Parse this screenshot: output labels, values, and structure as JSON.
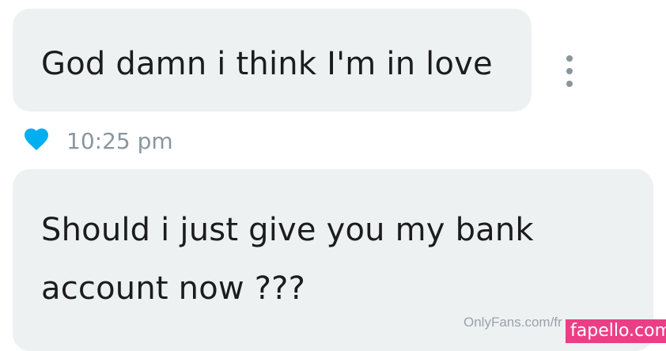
{
  "messages": [
    {
      "text": "God damn i think I'm in love"
    },
    {
      "text": "Should i just give you my bank account now ???"
    }
  ],
  "message_meta": {
    "time": "10:25 pm",
    "liked": true,
    "icon": "heart-icon"
  },
  "more_menu": {
    "icon": "vertical-dots-icon"
  },
  "watermarks": {
    "onlyfans": "OnlyFans.com/fr",
    "fapello": "fapello.com"
  },
  "colors": {
    "bubble_bg": "#eef1f2",
    "heart": "#00aff0",
    "timestamp": "#8a96a0",
    "dots": "#8a969b",
    "fapello_bg": "#ea3f86"
  }
}
